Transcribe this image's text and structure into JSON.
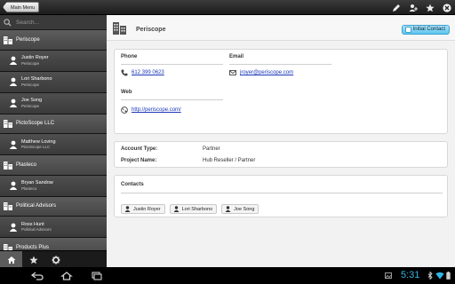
{
  "topbar": {
    "main_menu_label": "Main Menu",
    "icons": [
      "edit-icon",
      "add-contact-icon",
      "star-icon",
      "close-icon"
    ]
  },
  "sidebar": {
    "search_placeholder": "Search...",
    "items": [
      {
        "type": "company",
        "name": "Periscope"
      },
      {
        "type": "contact",
        "name": "Justin Royer",
        "company": "Periscope"
      },
      {
        "type": "contact",
        "name": "Lori Sharbono",
        "company": "Periscope"
      },
      {
        "type": "contact",
        "name": "Joe Song",
        "company": "Periscope"
      },
      {
        "type": "company",
        "name": "PictoScope LLC"
      },
      {
        "type": "contact",
        "name": "Matthew Loving",
        "company": "PictoScope LLC"
      },
      {
        "type": "company",
        "name": "Plasteco"
      },
      {
        "type": "contact",
        "name": "Bryan Sandow",
        "company": "Plasteco"
      },
      {
        "type": "company",
        "name": "Political Advisors"
      },
      {
        "type": "contact",
        "name": "Ross Hunt",
        "company": "Political Advisors"
      },
      {
        "type": "company",
        "name": "Products Plus"
      }
    ],
    "tabs": [
      "home-icon",
      "star-icon",
      "gear-icon"
    ]
  },
  "detail": {
    "company_name": "Periscope",
    "initial_contact_label": "Initial Contact",
    "phone_label": "Phone",
    "phone_value": "612 399 0623",
    "email_label": "Email",
    "email_value": "jroyer@periscope.com",
    "web_label": "Web",
    "web_value": "http://periscope.com/",
    "account_type_label": "Account Type:",
    "account_type_value": "Partner",
    "project_name_label": "Project Name:",
    "project_name_value": "Hub Reseller / Partner",
    "contacts_label": "Contacts",
    "contacts": [
      "Justin Royer",
      "Lori Sharbono",
      "Joe Song"
    ]
  },
  "system": {
    "time": "5:31"
  },
  "colors": {
    "accent": "#33b5e5",
    "initial_contact_bg": "#5cc4ef",
    "link": "#1a37b8"
  }
}
